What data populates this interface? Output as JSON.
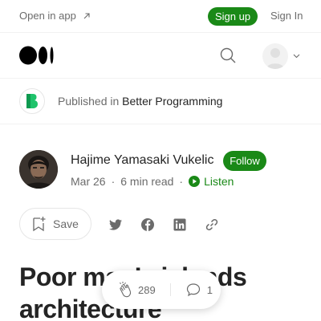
{
  "topbar": {
    "open_app": "Open in app",
    "sign_up": "Sign up",
    "sign_in": "Sign In"
  },
  "publication": {
    "prefix": "Published in",
    "name": "Better Programming"
  },
  "author": {
    "name": "Hajime Yamasaki Vukelic",
    "follow": "Follow"
  },
  "meta": {
    "date": "Mar 26",
    "dot1": "·",
    "read_time": "6 min read",
    "dot2": "·",
    "listen": "Listen"
  },
  "actions": {
    "save": "Save"
  },
  "article": {
    "title_line1": "Poor man’s islands",
    "title_line2": "architecture"
  },
  "clapbar": {
    "claps": "289",
    "responses": "1"
  },
  "colors": {
    "brand_green": "#1a8917",
    "text": "#242424",
    "muted": "#6b6b6b"
  }
}
